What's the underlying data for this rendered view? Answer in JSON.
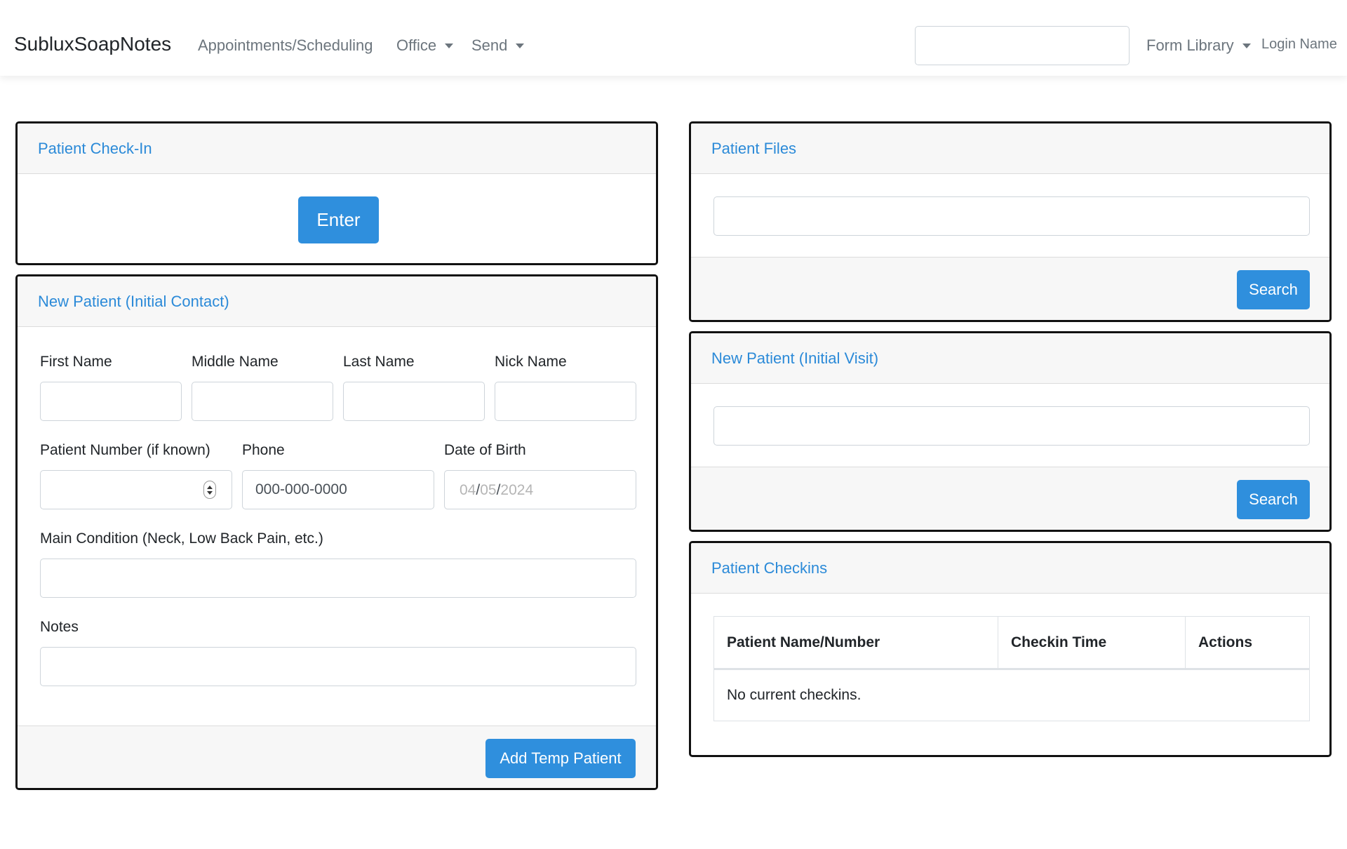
{
  "navbar": {
    "brand": "SubluxSoapNotes",
    "links": {
      "appointments": "Appointments/Scheduling",
      "office": "Office",
      "send": "Send",
      "form_library": "Form Library",
      "login_name": "Login Name"
    },
    "search_value": ""
  },
  "check_in": {
    "title": "Patient Check-In",
    "enter_label": "Enter"
  },
  "new_patient_contact": {
    "title": "New Patient (Initial Contact)",
    "first_name_label": "First Name",
    "middle_name_label": "Middle Name",
    "last_name_label": "Last Name",
    "nick_name_label": "Nick Name",
    "patient_number_label": "Patient Number (if known)",
    "phone_label": "Phone",
    "phone_placeholder": "000-000-0000",
    "dob_label": "Date of Birth",
    "dob": {
      "month": "04",
      "day": "05",
      "year": "2024",
      "separator": "/"
    },
    "main_condition_label": "Main Condition (Neck, Low Back Pain, etc.)",
    "notes_label": "Notes",
    "add_button_label": "Add Temp Patient"
  },
  "patient_files": {
    "title": "Patient Files",
    "search_label": "Search"
  },
  "new_patient_visit": {
    "title": "New Patient (Initial Visit)",
    "search_label": "Search"
  },
  "checkins": {
    "title": "Patient Checkins",
    "columns": [
      "Patient Name/Number",
      "Checkin Time",
      "Actions"
    ],
    "empty_message": "No current checkins."
  },
  "colors": {
    "accent": "#2f8fdd",
    "title_blue": "#2b8ad8",
    "card_border": "#111111"
  }
}
